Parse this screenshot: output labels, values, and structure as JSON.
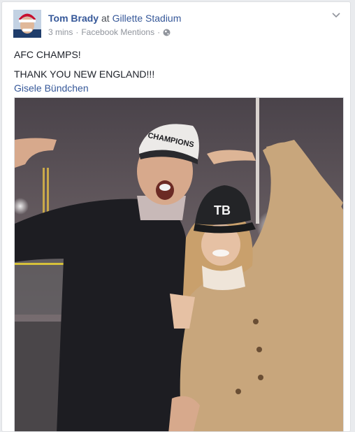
{
  "post": {
    "author": "Tom Brady",
    "at_text": "at",
    "place": "Gillette Stadium",
    "time": "3 mins",
    "separator": "·",
    "source": "Facebook Mentions",
    "separator2": "·",
    "privacy_icon": "globe-icon",
    "menu_icon": "chevron-down-icon",
    "text_lines": [
      "AFC CHAMPS!",
      "THANK YOU NEW ENGLAND!!!"
    ],
    "tagged_person": "Gisele Bündchen",
    "photo": {
      "description_icon": "photo",
      "cap_text": "CHAMPIONS",
      "cap2_text": "TB"
    }
  },
  "colors": {
    "link": "#365899",
    "meta": "#90949c",
    "text": "#1d2129"
  }
}
